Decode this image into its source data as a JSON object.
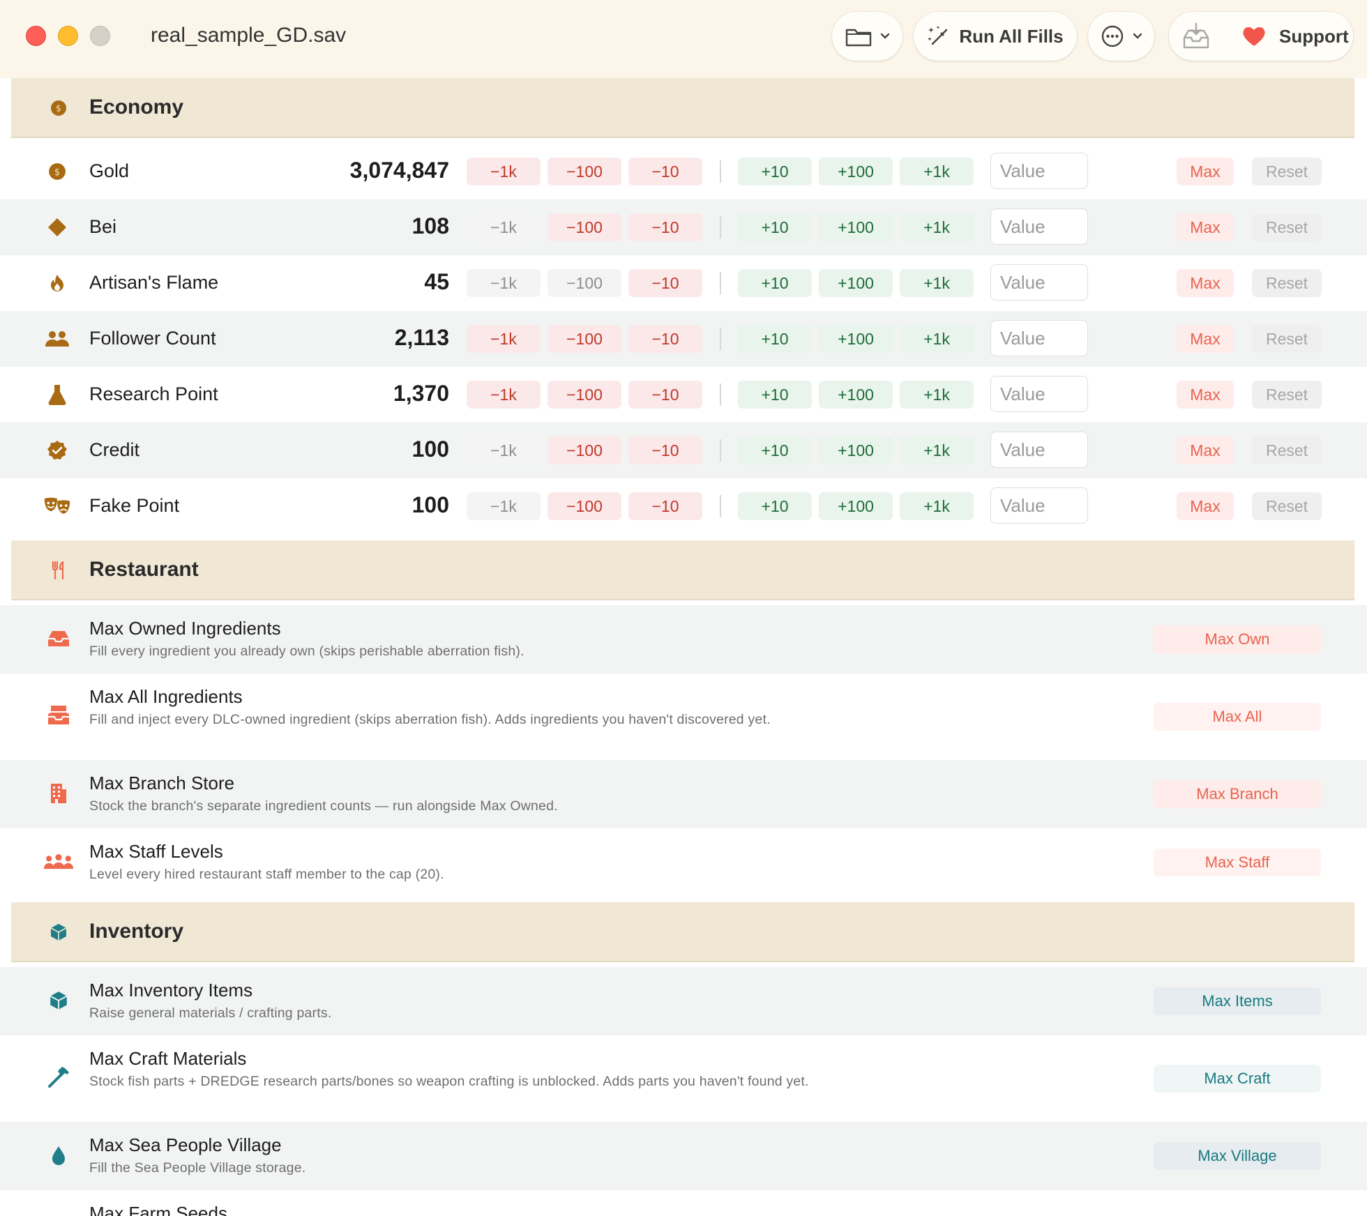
{
  "window": {
    "title": "real_sample_GD.sav"
  },
  "toolbar": {
    "run_all_label": "Run All Fills",
    "support_label": "Support"
  },
  "colors": {
    "economy_icon": "#a86a12",
    "restaurant_icon": "#ef6a4c",
    "inventory_icon": "#1f7e88"
  },
  "economy": {
    "title": "Economy",
    "icon": "coin-icon",
    "input_placeholder": "Value",
    "buttons": {
      "minus_1k": "−1k",
      "minus_100": "−100",
      "minus_10": "−10",
      "plus_10": "+10",
      "plus_100": "+100",
      "plus_1k": "+1k",
      "max": "Max",
      "reset": "Reset"
    },
    "rows": [
      {
        "icon": "coin-icon",
        "label": "Gold",
        "value": "3,074,847"
      },
      {
        "icon": "diamond-icon",
        "label": "Bei",
        "value": "108"
      },
      {
        "icon": "flame-icon",
        "label": "Artisan's Flame",
        "value": "45"
      },
      {
        "icon": "people-icon",
        "label": "Follower Count",
        "value": "2,113"
      },
      {
        "icon": "flask-icon",
        "label": "Research Point",
        "value": "1,370"
      },
      {
        "icon": "badge-check-icon",
        "label": "Credit",
        "value": "100"
      },
      {
        "icon": "masks-icon",
        "label": "Fake Point",
        "value": "100"
      }
    ]
  },
  "restaurant": {
    "title": "Restaurant",
    "icon": "fork-knife-icon",
    "rows": [
      {
        "icon": "tray-icon",
        "title": "Max Owned Ingredients",
        "desc": "Fill every ingredient you already own (skips perishable aberration fish).",
        "button": "Max Own"
      },
      {
        "icon": "tray-full-icon",
        "title": "Max All Ingredients",
        "desc": "Fill and inject every DLC-owned ingredient (skips aberration fish). Adds ingredients you haven't discovered yet.",
        "button": "Max All"
      },
      {
        "icon": "building-icon",
        "title": "Max Branch Store",
        "desc": "Stock the branch's separate ingredient counts — run alongside Max Owned.",
        "button": "Max Branch"
      },
      {
        "icon": "group-icon",
        "title": "Max Staff Levels",
        "desc": "Level every hired restaurant staff member to the cap (20).",
        "button": "Max Staff"
      }
    ]
  },
  "inventory": {
    "title": "Inventory",
    "icon": "cube-icon",
    "rows": [
      {
        "icon": "cube-icon",
        "title": "Max Inventory Items",
        "desc": "Raise general materials / crafting parts.",
        "button": "Max Items"
      },
      {
        "icon": "hammer-icon",
        "title": "Max Craft Materials",
        "desc": "Stock fish parts + DREDGE research parts/bones so weapon crafting is unblocked. Adds parts you haven't found yet.",
        "button": "Max Craft"
      },
      {
        "icon": "drop-icon",
        "title": "Max Sea People Village",
        "desc": "Fill the Sea People Village storage.",
        "button": "Max Village"
      },
      {
        "icon": "seed-icon",
        "title": "Max Farm Seeds",
        "desc": "",
        "button": ""
      }
    ]
  }
}
